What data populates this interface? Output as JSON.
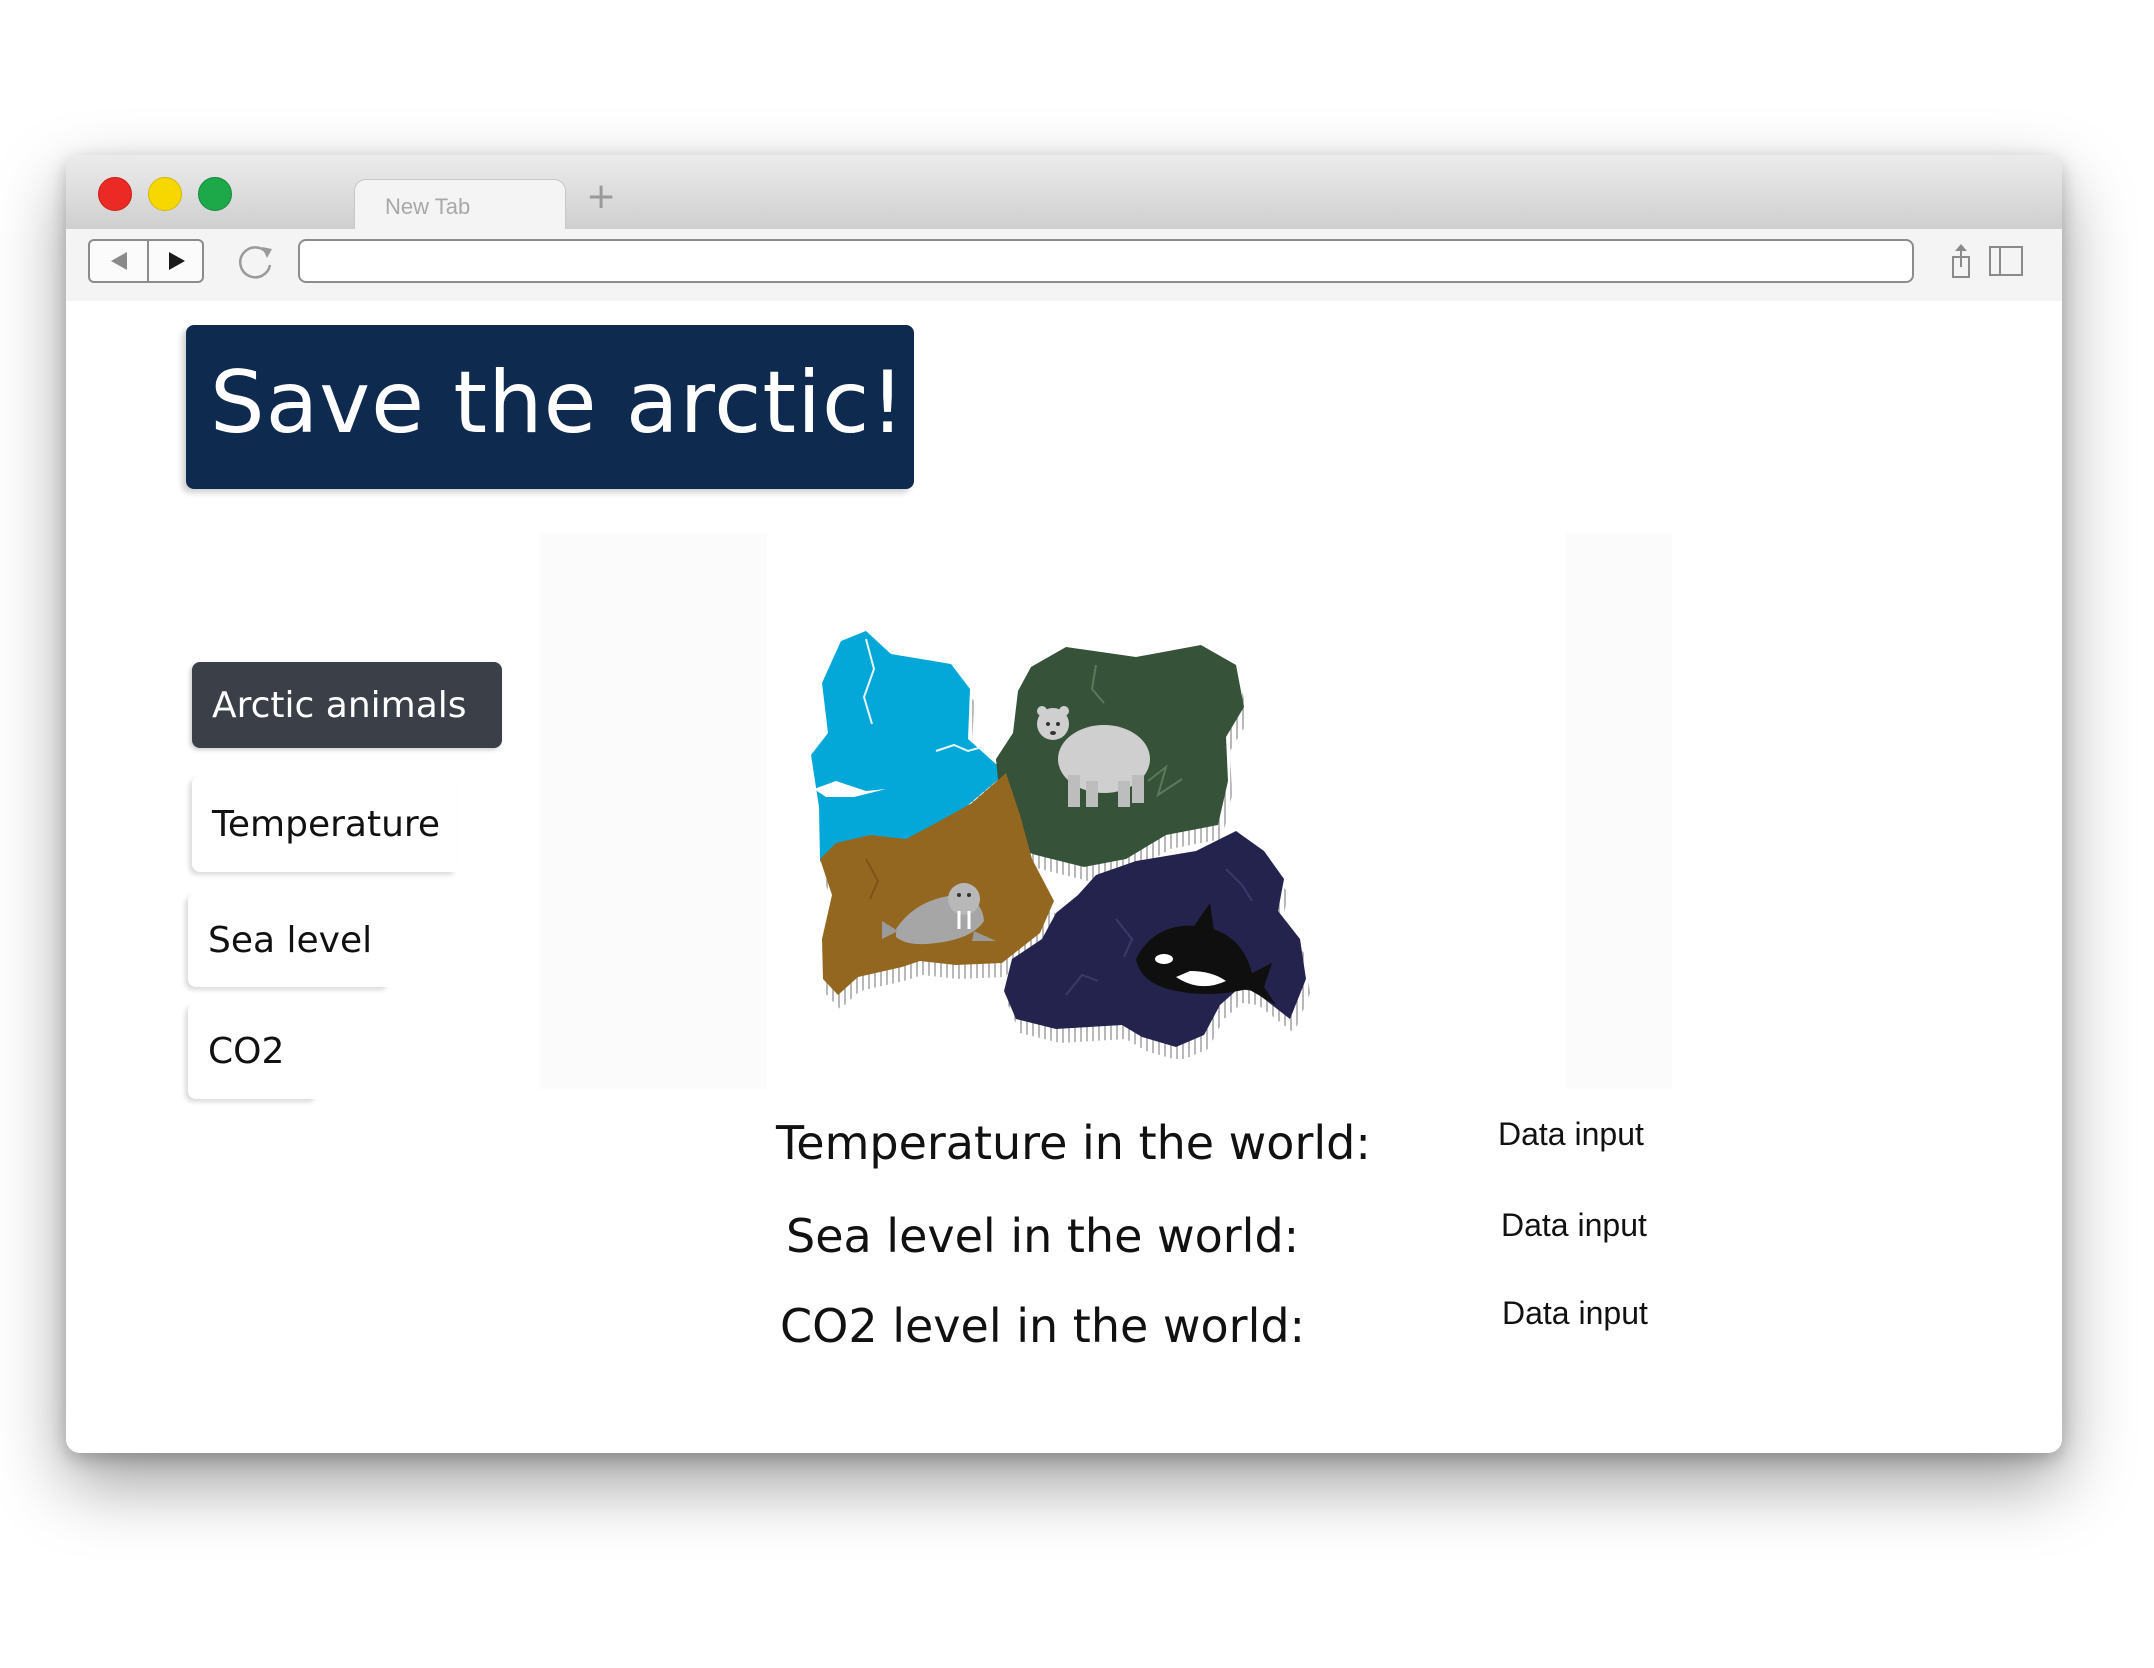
{
  "browser": {
    "tab_title": "New Tab",
    "new_tab_symbol": "+",
    "url": ""
  },
  "page": {
    "title": "Save the arctic!",
    "colors": {
      "title_banner": "#0f2a4f",
      "menu_active": "#3b3f48",
      "ice_region": "#03a8d8",
      "forest_region": "#365239",
      "sand_region": "#946721",
      "ocean_region": "#23234d"
    },
    "menu": [
      {
        "label": "Arctic  animals",
        "active": true
      },
      {
        "label": "Temperature",
        "active": false
      },
      {
        "label": "Sea level",
        "active": false
      },
      {
        "label": "CO2",
        "active": false
      }
    ],
    "map_icons": [
      "polar-bear-icon",
      "walrus-icon",
      "orca-icon"
    ],
    "stats": [
      {
        "label": "Temperature in the world:",
        "value": "Data input"
      },
      {
        "label": "Sea level in the world:",
        "value": "Data input"
      },
      {
        "label": "CO2 level in the world:",
        "value": "Data input"
      }
    ]
  }
}
